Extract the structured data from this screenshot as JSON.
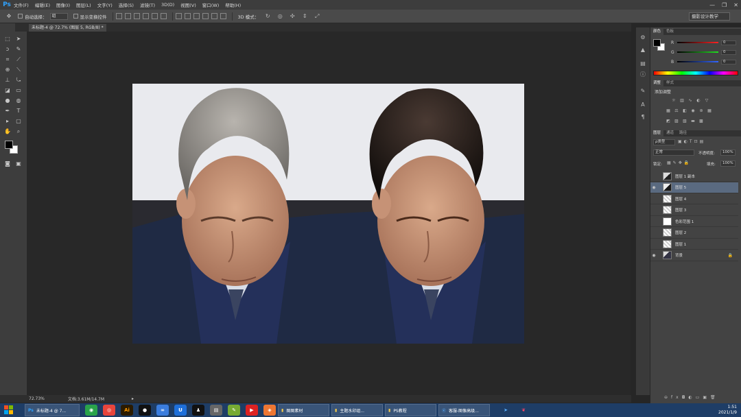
{
  "app": {
    "logo": "Ps"
  },
  "menu": [
    "文件(F)",
    "编辑(E)",
    "图像(I)",
    "图层(L)",
    "文字(Y)",
    "选择(S)",
    "滤镜(T)",
    "3D(D)",
    "视图(V)",
    "窗口(W)",
    "帮助(H)"
  ],
  "window_controls": {
    "minimize": "—",
    "restore": "❐",
    "close": "✕"
  },
  "options_bar": {
    "auto_select_label": "自动选择：",
    "auto_select_value": "组",
    "show_transform_label": "显示变换控件",
    "mode_3d_label": "3D 模式：",
    "workspace": "摄影设计教学"
  },
  "document_tab": {
    "title": "未标题-4 @ 72.7% (图层 5, RGB/8) *"
  },
  "status": {
    "zoom": "72.73%",
    "doc_size": "文档:3.61M/14.7M"
  },
  "panels": {
    "color": {
      "tabs": [
        "颜色",
        "色板"
      ],
      "channels": [
        {
          "label": "R",
          "value": "0"
        },
        {
          "label": "G",
          "value": "0"
        },
        {
          "label": "B",
          "value": "0"
        }
      ]
    },
    "adjustments": {
      "tabs": [
        "调整",
        "样式"
      ],
      "title": "添加调整"
    },
    "layers": {
      "tabs": [
        "图层",
        "通道",
        "路径"
      ],
      "filter_label": "ρ类型",
      "blend_mode": "正常",
      "opacity_label": "不透明度:",
      "opacity_value": "100%",
      "lock_label": "锁定:",
      "fill_label": "填充:",
      "fill_value": "100%",
      "items": [
        {
          "name": "图层 1 副本",
          "visible": false,
          "selected": false
        },
        {
          "name": "图层 5",
          "visible": true,
          "selected": true
        },
        {
          "name": "图层 4",
          "visible": false,
          "selected": false
        },
        {
          "name": "图层 3",
          "visible": false,
          "selected": false
        },
        {
          "name": "色彩范围 1",
          "visible": false,
          "selected": false
        },
        {
          "name": "图层 2",
          "visible": false,
          "selected": false
        },
        {
          "name": "图层 1",
          "visible": false,
          "selected": false
        },
        {
          "name": "背景",
          "visible": true,
          "selected": false
        }
      ]
    }
  },
  "taskbar": {
    "buttons": [
      "未标题-4 @ 7...",
      "图图素材",
      "主题水印组...",
      "PS教程",
      "客服-图像高级..."
    ],
    "clock_time": "1:51",
    "clock_date": "2021/1/9"
  },
  "colors": {
    "accent_blue": "#2fa3ff",
    "taskbar": "#1e3d66",
    "layer_selected": "#5a6a80"
  }
}
